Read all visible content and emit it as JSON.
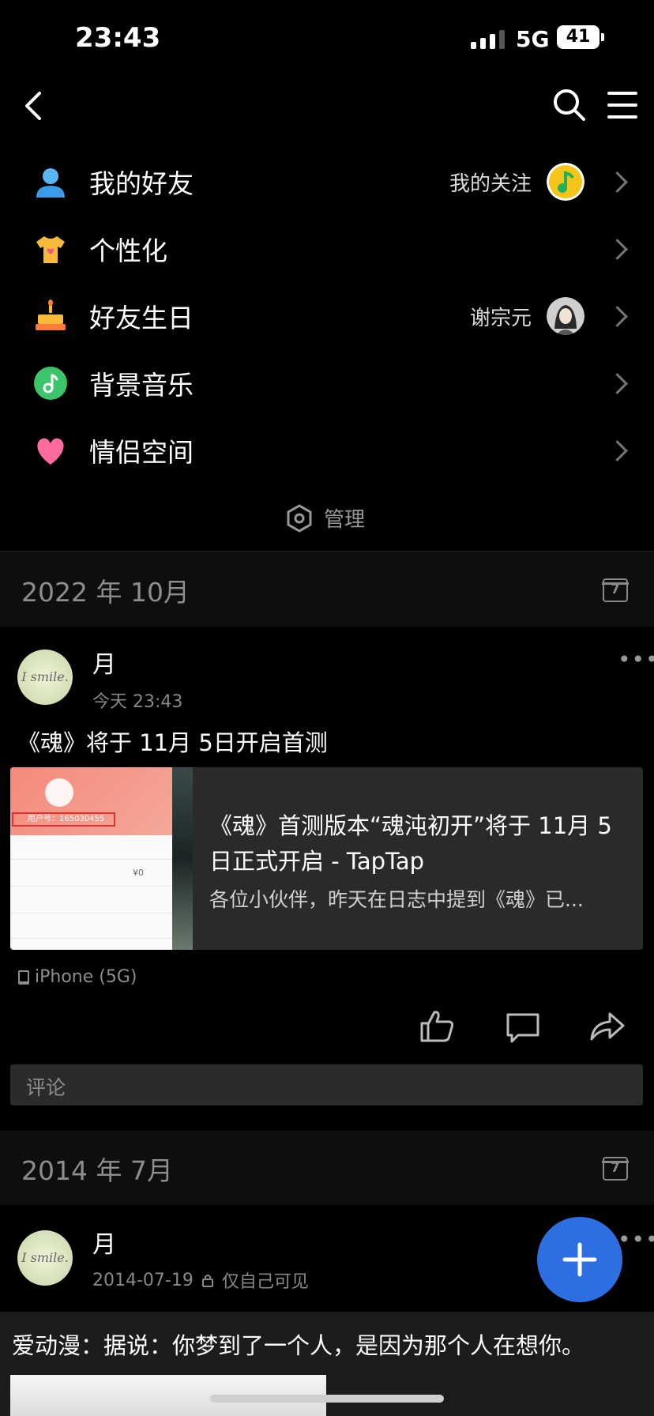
{
  "status_bar": {
    "time": "23:43",
    "network": "5G",
    "battery": "41"
  },
  "menu": [
    {
      "label": "我的好友",
      "sub": "我的关注",
      "icon": "friend-icon",
      "avatar": "qq-music-avatar"
    },
    {
      "label": "个性化",
      "sub": "",
      "icon": "tshirt-icon",
      "avatar": ""
    },
    {
      "label": "好友生日",
      "sub": "谢宗元",
      "icon": "cake-icon",
      "avatar": "friend-avatar"
    },
    {
      "label": "背景音乐",
      "sub": "",
      "icon": "music-note-icon",
      "avatar": ""
    },
    {
      "label": "情侣空间",
      "sub": "",
      "icon": "heart-icon",
      "avatar": ""
    }
  ],
  "manage_label": "管理",
  "sections": [
    {
      "month": "2022 年 10月",
      "calendar_day": "7"
    },
    {
      "month": "2014 年 7月",
      "calendar_day": "7"
    }
  ],
  "post1": {
    "avatar_text": "I smile.",
    "name": "月",
    "time": "今天 23:43",
    "text": "《魂》将于 11月 5日开启首测",
    "link": {
      "title": "《魂》首测版本“魂沌初开”将于 11月 5日正式开启 - TapTap",
      "desc": "各位小伙伴，昨天在日志中提到《魂》已...",
      "thumb_user_id": "用户号：165030455",
      "thumb_amount": "¥0"
    },
    "device": "iPhone (5G)",
    "comment_placeholder": "评论"
  },
  "post2": {
    "avatar_text": "I smile.",
    "name": "月",
    "date": "2014-07-19",
    "visibility": "仅自己可见",
    "text": "爱动漫：据说：你梦到了一个人，是因为那个人在想你。"
  },
  "colors": {
    "fab": "#2d6fe0",
    "background": "#000000"
  }
}
